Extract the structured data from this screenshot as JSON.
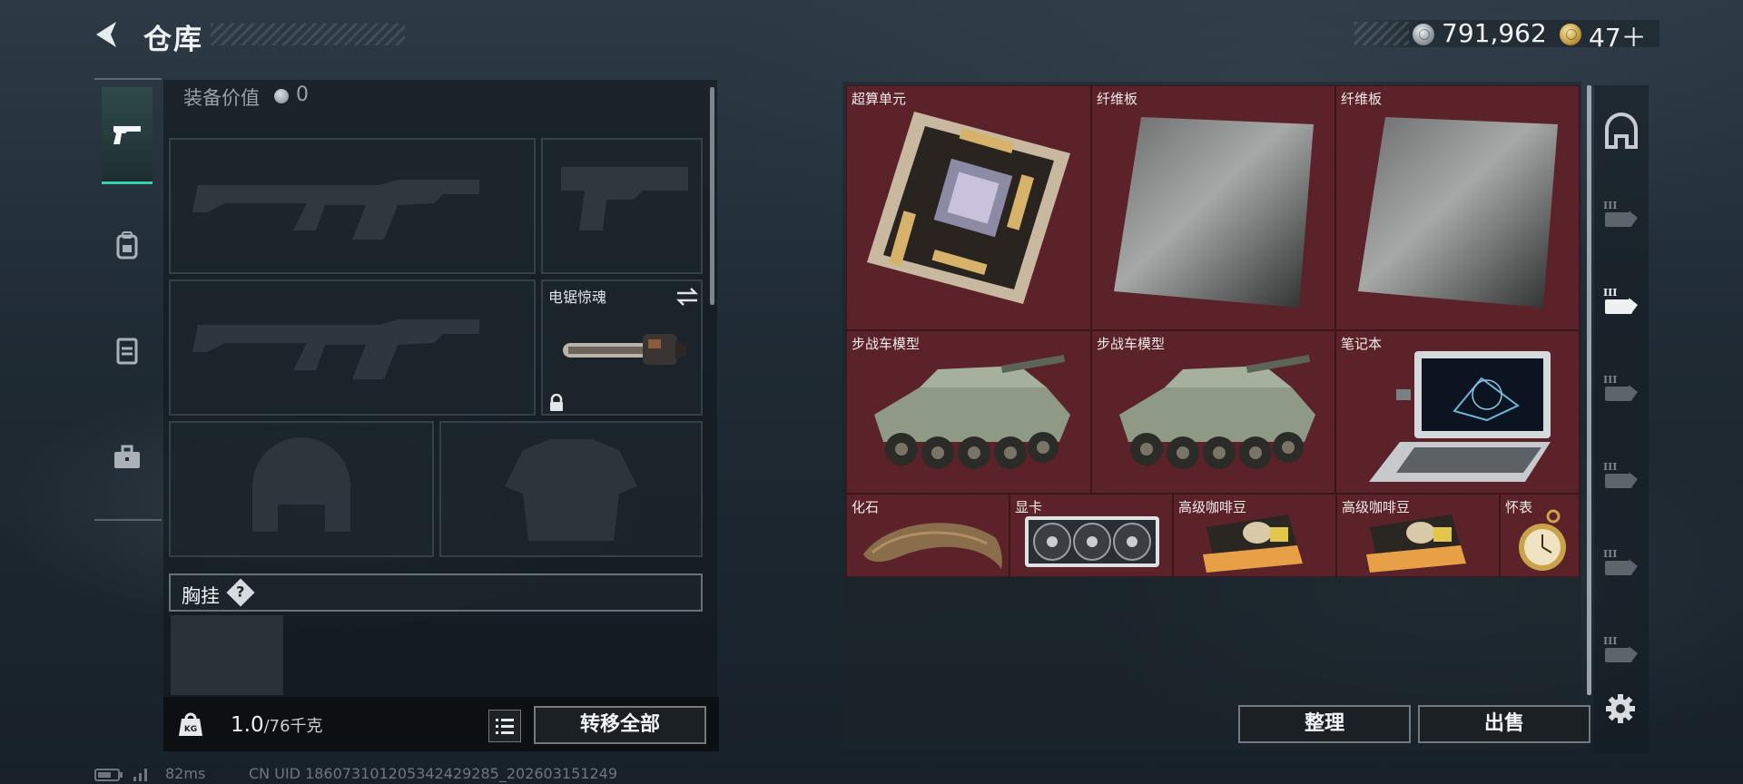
{
  "header": {
    "title": "仓库",
    "back_icon": "chevron-left-icon"
  },
  "currency": {
    "silver": "791,962",
    "gold": "47＋",
    "silver_icon": "silver-coin-icon",
    "gold_icon": "gold-coin-icon"
  },
  "loadout": {
    "tabs": [
      {
        "icon": "pistol-icon",
        "active": true
      },
      {
        "icon": "backpack-icon",
        "active": false
      },
      {
        "icon": "vest-icon",
        "active": false
      },
      {
        "icon": "briefcase-icon",
        "active": false
      }
    ],
    "equip_value_label": "装备价值",
    "equip_value": "0",
    "secondary_weapon": {
      "label": "电锯惊魂",
      "locked": true
    },
    "chest_rig_label": "胸挂",
    "help_mark": "?",
    "weight_current": "1.0",
    "weight_max": "/76千克",
    "transfer_all_label": "转移全部"
  },
  "status": {
    "ping": "82ms",
    "uid": "CN UID 1860731012053424292​85_202603151249"
  },
  "storage": {
    "items": [
      {
        "name": "超算单元"
      },
      {
        "name": "纤维板"
      },
      {
        "name": "纤维板"
      },
      {
        "name": "步战车模型"
      },
      {
        "name": "步战车模型"
      },
      {
        "name": "笔记本"
      },
      {
        "name": "化石"
      },
      {
        "name": "显卡"
      },
      {
        "name": "高级咖啡豆"
      },
      {
        "name": "高级咖啡豆"
      },
      {
        "name": "怀表"
      }
    ],
    "tidy_label": "整理",
    "sell_label": "出售",
    "side_tabs": [
      {
        "icon": "safe-box-icon",
        "tier": ""
      },
      {
        "icon": "storage-tab-icon",
        "tier": "III"
      },
      {
        "icon": "storage-tab-icon",
        "tier": "III",
        "active": true
      },
      {
        "icon": "storage-tab-icon",
        "tier": "III"
      },
      {
        "icon": "storage-tab-icon",
        "tier": "III"
      },
      {
        "icon": "storage-tab-icon",
        "tier": "III"
      },
      {
        "icon": "storage-tab-icon",
        "tier": "III"
      }
    ]
  },
  "colors": {
    "accent_green": "#38d2a8",
    "storage_red": "#5a2127"
  }
}
